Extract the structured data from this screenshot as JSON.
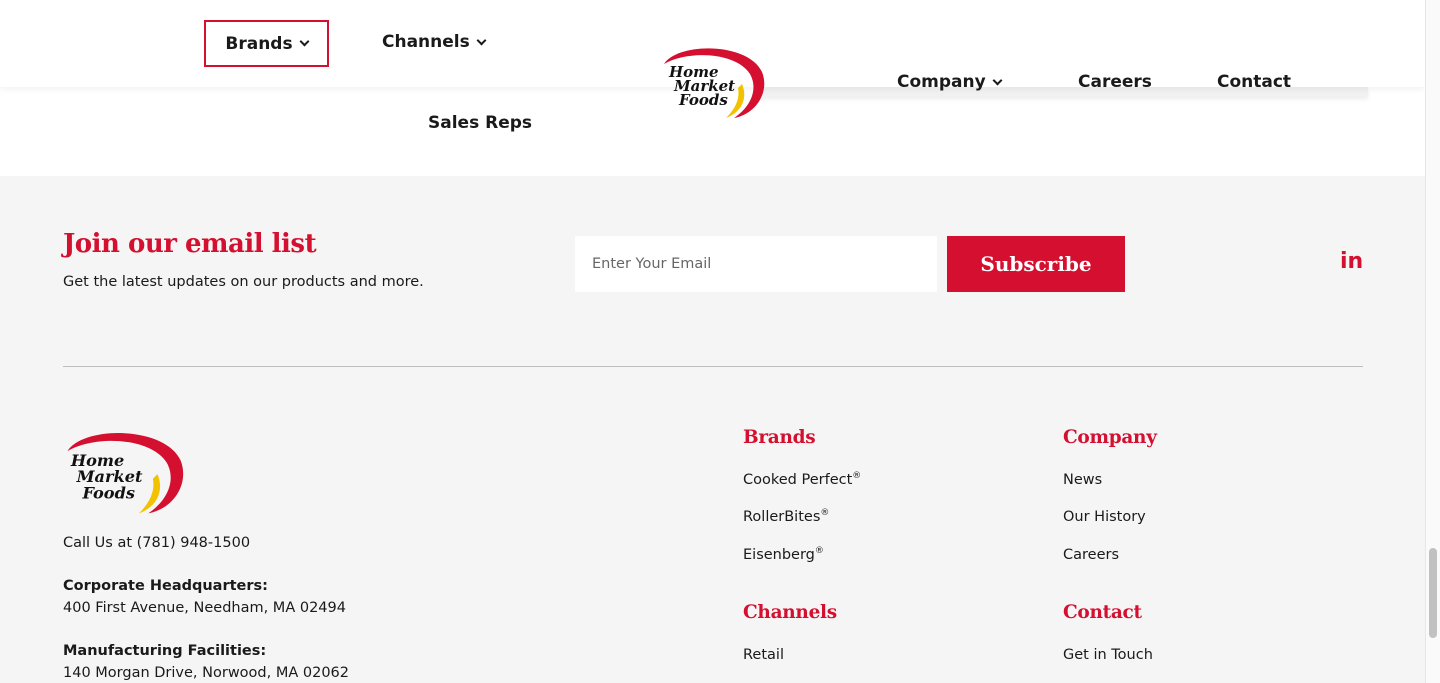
{
  "colors": {
    "brand_red": "#d40f2f",
    "text": "#1a1a1a",
    "footer_bg": "#f5f5f5"
  },
  "logo": {
    "line1": "Home",
    "line2": "Market",
    "line3": "Foods"
  },
  "nav": {
    "brands": "Brands",
    "channels": "Channels",
    "company": "Company",
    "careers": "Careers",
    "contact": "Contact",
    "sales_reps": "Sales Reps"
  },
  "newsletter": {
    "title": "Join our email list",
    "subtitle": "Get the latest updates on our products and more.",
    "email_placeholder": "Enter Your Email",
    "subscribe_label": "Subscribe",
    "social_icon": "linkedin-icon",
    "social_label": "in"
  },
  "contact_info": {
    "phone": "Call Us at (781) 948-1500",
    "hq_label": "Corporate Headquarters:",
    "hq_address": "400 First Avenue, Needham, MA 02494",
    "mfg_label": "Manufacturing Facilities:",
    "mfg_address": "140 Morgan Drive, Norwood, MA 02062"
  },
  "footer_nav": {
    "brands": {
      "heading": "Brands",
      "items": [
        {
          "label": "Cooked Perfect",
          "mark": "®"
        },
        {
          "label": "RollerBites",
          "mark": "®"
        },
        {
          "label": "Eisenberg",
          "mark": "®"
        }
      ]
    },
    "company": {
      "heading": "Company",
      "items": [
        "News",
        "Our History",
        "Careers"
      ]
    },
    "channels": {
      "heading": "Channels",
      "items": [
        "Retail"
      ]
    },
    "contact": {
      "heading": "Contact",
      "items": [
        "Get in Touch"
      ]
    }
  }
}
